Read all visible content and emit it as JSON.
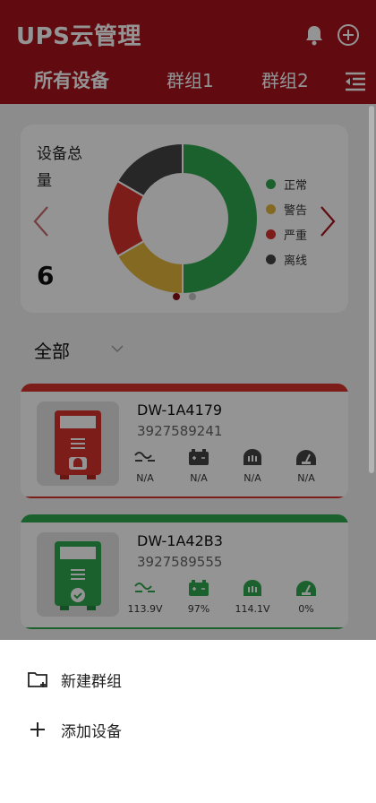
{
  "header": {
    "title": "UPS云管理",
    "tabs": [
      {
        "label": "所有设备",
        "active": true
      },
      {
        "label": "群组1",
        "active": false
      },
      {
        "label": "群组2",
        "active": false
      }
    ],
    "icons": [
      "bell-icon",
      "add-circle-icon",
      "menu-collapse-icon"
    ],
    "color": "#a8131c"
  },
  "summary": {
    "title": "设备总量",
    "count": "6",
    "legend": [
      {
        "label": "正常",
        "color": "#2fa84f"
      },
      {
        "label": "警告",
        "color": "#e2b53a"
      },
      {
        "label": "严重",
        "color": "#d8322c"
      },
      {
        "label": "离线",
        "color": "#444444"
      }
    ],
    "pager": {
      "pages": 2,
      "current": 1
    }
  },
  "chart_data": {
    "type": "pie",
    "categories": [
      "正常",
      "警告",
      "严重",
      "离线"
    ],
    "values": [
      3,
      1,
      1,
      1
    ],
    "colors": [
      "#2fa84f",
      "#e2b53a",
      "#d8322c",
      "#444444"
    ],
    "donut": true
  },
  "filter": {
    "label": "全部"
  },
  "devices": [
    {
      "name": "DW-1A4179",
      "serial": "3927589241",
      "status_color": "#d8322c",
      "metrics": [
        {
          "icon": "input-voltage-icon",
          "value": "N/A"
        },
        {
          "icon": "battery-icon",
          "value": "N/A"
        },
        {
          "icon": "output-voltage-icon",
          "value": "N/A"
        },
        {
          "icon": "load-gauge-icon",
          "value": "N/A"
        }
      ]
    },
    {
      "name": "DW-1A42B3",
      "serial": "3927589555",
      "status_color": "#2fa84f",
      "metrics": [
        {
          "icon": "input-voltage-icon",
          "value": "113.9V"
        },
        {
          "icon": "battery-icon",
          "value": "97%"
        },
        {
          "icon": "output-voltage-icon",
          "value": "114.1V"
        },
        {
          "icon": "load-gauge-icon",
          "value": "0%"
        }
      ]
    }
  ],
  "sheet": {
    "items": [
      {
        "label": "新建群组",
        "icon": "new-folder-icon"
      },
      {
        "label": "添加设备",
        "icon": "plus-icon"
      }
    ]
  }
}
